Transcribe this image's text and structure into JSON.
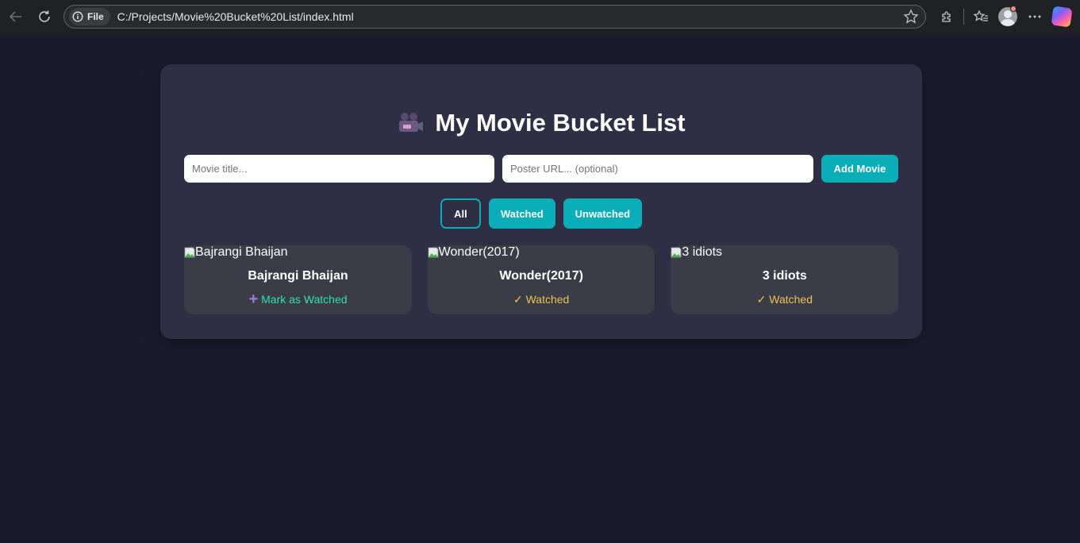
{
  "browser": {
    "site_chip": "File",
    "url": "C:/Projects/Movie%20Bucket%20List/index.html"
  },
  "app": {
    "title": "My Movie Bucket List",
    "title_icon": "movie-camera-icon"
  },
  "form": {
    "title_placeholder": "Movie title...",
    "poster_placeholder": "Poster URL... (optional)",
    "add_label": "Add Movie"
  },
  "filters": [
    {
      "label": "All",
      "active": true
    },
    {
      "label": "Watched",
      "active": false
    },
    {
      "label": "Unwatched",
      "active": false
    }
  ],
  "movies": [
    {
      "poster_alt": "Bajrangi Bhaijan",
      "title": "Bajrangi Bhaijan",
      "status": "Mark as Watched",
      "status_icon": "plus-icon",
      "watched": false
    },
    {
      "poster_alt": "Wonder(2017)",
      "title": "Wonder(2017)",
      "status": "✓ Watched",
      "watched": true
    },
    {
      "poster_alt": "3 idiots",
      "title": "3 idiots",
      "status": "✓ Watched",
      "watched": true
    }
  ],
  "colors": {
    "accent": "#0aadb8",
    "page_bg": "#1b1b2d",
    "card_bg": "#2e2e45",
    "movie_bg": "#3a3c47",
    "unwatched": "#2ee3b0",
    "watched": "#f2c14e"
  }
}
